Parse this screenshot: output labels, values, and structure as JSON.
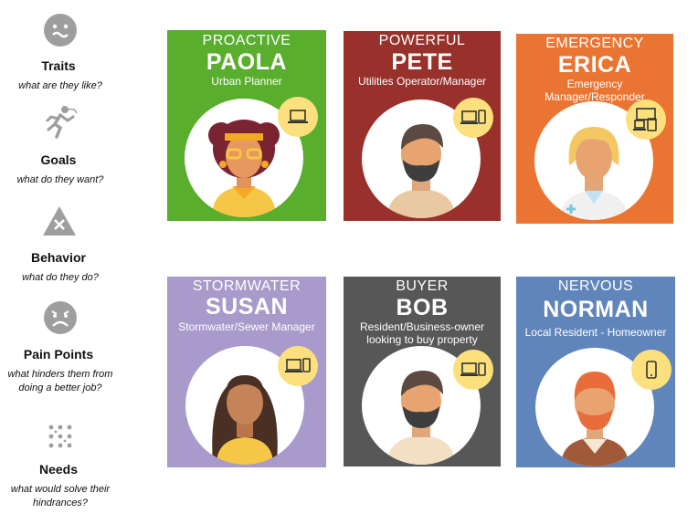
{
  "legend": [
    {
      "icon": "neutral-face-icon",
      "title": "Traits",
      "subtitle": "what are they like?"
    },
    {
      "icon": "running-figure-icon",
      "title": "Goals",
      "subtitle": "what do they want?"
    },
    {
      "icon": "warning-triangle-icon",
      "title": "Behavior",
      "subtitle": "what do they do?"
    },
    {
      "icon": "sad-face-icon",
      "title": "Pain Points",
      "subtitle": "what hinders them from doing a better job?"
    },
    {
      "icon": "dots-grid-icon",
      "title": "Needs",
      "subtitle": "what would solve their hindrances?"
    }
  ],
  "personas": [
    {
      "adjective": "PROACTIVE",
      "name": "PAOLA",
      "role": "Urban Planner",
      "color": "#5aae2e",
      "devices": "laptop-icon"
    },
    {
      "adjective": "POWERFUL",
      "name": "PETE",
      "role": "Utilities Operator/Manager",
      "color": "#98312b",
      "devices": "laptop-phone-icon"
    },
    {
      "adjective": "EMERGENCY",
      "name": "ERICA",
      "role": "Emergency Manager/Responder",
      "color": "#ea7532",
      "devices": "multi-device-icon"
    },
    {
      "adjective": "STORMWATER",
      "name": "SUSAN",
      "role": "Stormwater/Sewer Manager",
      "color": "#a89bcb",
      "devices": "laptop-phone-icon"
    },
    {
      "adjective": "BUYER",
      "name": "BOB",
      "role": "Resident/Business-owner looking to buy property",
      "color": "#575757",
      "devices": "laptop-tablet-icon"
    },
    {
      "adjective": "NERVOUS",
      "name": "NORMAN",
      "role": "Local Resident - Homeowner",
      "color": "#5f85ba",
      "devices": "phone-icon"
    }
  ]
}
